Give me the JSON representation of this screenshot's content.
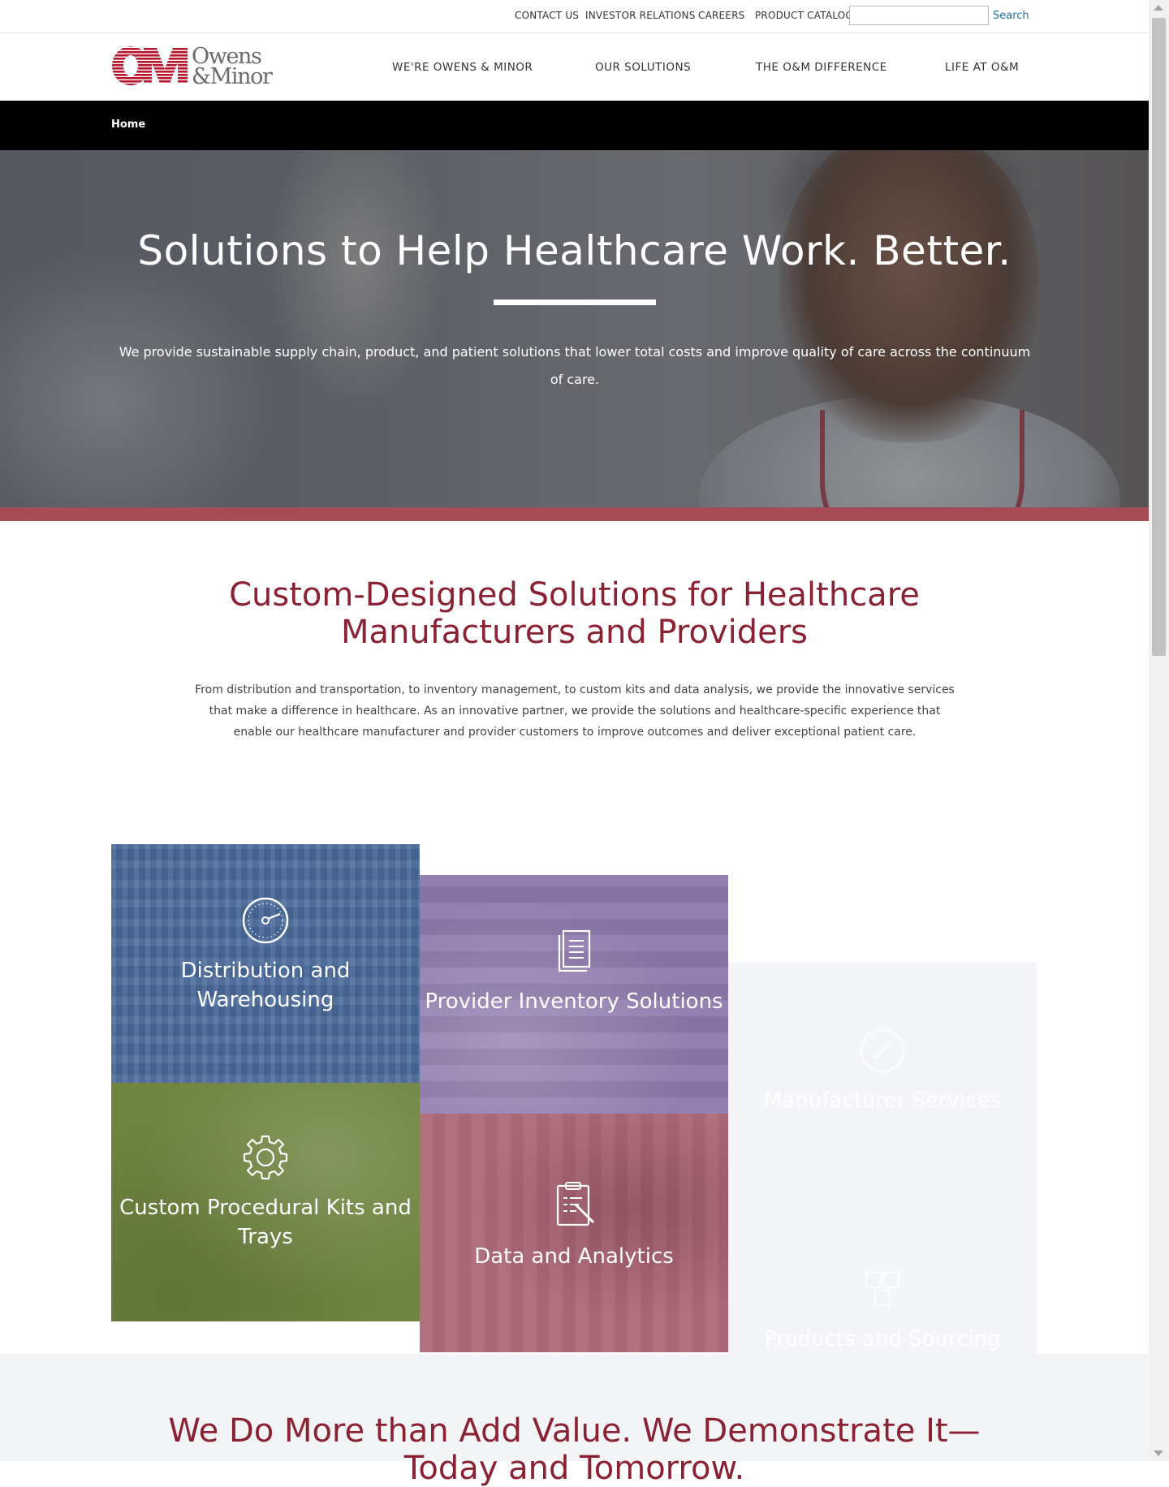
{
  "utility_nav": {
    "items": [
      "CONTACT US",
      "INVESTOR RELATIONS",
      "CAREERS",
      "PRODUCT CATALOG"
    ],
    "search_value": "",
    "search_button": "Search"
  },
  "logo": {
    "mark": "OM",
    "line1": "Owens",
    "line2": "&Minor",
    "color": "#b5162b"
  },
  "main_nav": {
    "items": [
      "WE'RE OWENS & MINOR",
      "OUR SOLUTIONS",
      "THE O&M DIFFERENCE",
      "LIFE AT O&M"
    ]
  },
  "breadcrumb": {
    "home": "Home"
  },
  "hero": {
    "title": "Solutions to Help Healthcare Work. Better.",
    "text": "We provide sustainable supply chain, product, and patient solutions that lower total costs and improve quality of care across the continuum of care."
  },
  "intro": {
    "heading": "Custom-Designed Solutions for Healthcare Manufacturers and Providers",
    "text": "From distribution and transportation, to inventory management, to custom kits and data analysis, we provide the innovative services that make a difference in healthcare. As an innovative partner, we provide the solutions and healthcare-specific experience that enable our healthcare manufacturer and provider customers to improve outcomes and deliver exceptional patient care."
  },
  "tiles": [
    {
      "label": "Distribution and Warehousing",
      "icon": "gauge-icon",
      "color": "#4b6b9c"
    },
    {
      "label": "Provider Inventory Solutions",
      "icon": "document-icon",
      "color": "#8e79ad"
    },
    {
      "label": "Manufacturer Services",
      "icon": "pencil-circle-icon",
      "color": "#f3f5f8"
    },
    {
      "label": "Custom Procedural Kits and Trays",
      "icon": "gear-icon",
      "color": "#6e8440"
    },
    {
      "label": "Data and Analytics",
      "icon": "clipboard-icon",
      "color": "#b06b7b"
    },
    {
      "label": "Products and Sourcing",
      "icon": "boxes-icon",
      "color": "#f3f5f8"
    }
  ],
  "bottom": {
    "heading": "We Do More than Add Value. We Demonstrate It—Today and Tomorrow."
  },
  "colors": {
    "brand_red": "#8a2234",
    "hero_strip": "#a64c56",
    "search_link": "#1a6fa3"
  }
}
